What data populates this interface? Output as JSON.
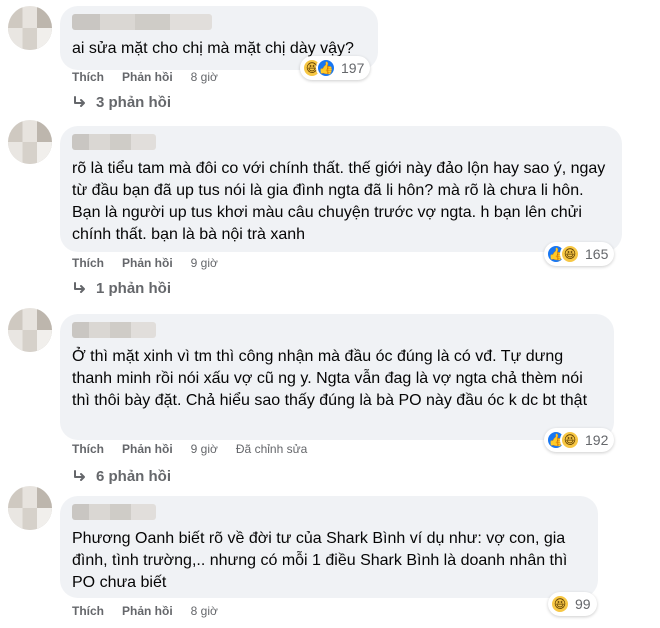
{
  "comments": [
    {
      "text": "ai sửa mặt cho chị mà mặt chị dày vậy?",
      "reaction_count": "197",
      "like_label": "Thích",
      "reply_label": "Phản hồi",
      "time": "8 giờ",
      "replies_label": "3 phản hồi"
    },
    {
      "text": "rõ là tiểu tam mà đôi co với chính thất. thế giới này đảo lộn hay sao ý, ngay từ đầu bạn đã up tus nói là gia đình ngta đã li hôn? mà rõ là chưa li hôn. Bạn là người up tus khơi màu câu chuyện trước vợ ngta. h bạn lên chửi chính thất. bạn là bà nội trà xanh",
      "reaction_count": "165",
      "like_label": "Thích",
      "reply_label": "Phản hồi",
      "time": "9 giờ",
      "replies_label": "1 phản hồi"
    },
    {
      "text": "Ở thì mặt xinh vì tm thì công nhận mà đầu óc đúng là có vđ. Tự dưng thanh minh rồi nói xấu vợ cũ ng y. Ngta vẫn đag là vợ ngta chả thèm nói thì thôi bày đặt. Chả hiểu sao thấy đúng là bà PO này đầu óc k dc bt thật",
      "reaction_count": "192",
      "like_label": "Thích",
      "reply_label": "Phản hồi",
      "time": "9 giờ",
      "edited": "Đã chỉnh sửa",
      "replies_label": "6 phản hồi"
    },
    {
      "text": "Phương Oanh biết rõ về đời tư của Shark Bình ví dụ như: vợ con, gia đình, tình trường,.. nhưng có mỗi 1 điều Shark Bình là doanh nhân thì PO chưa biết",
      "reaction_count": "99",
      "like_label": "Thích",
      "reply_label": "Phản hồi",
      "time": "8 giờ"
    }
  ],
  "icons": {
    "like": "like-icon",
    "haha": "haha-icon",
    "reply_arrow": "reply-arrow-icon"
  },
  "colors": {
    "bubble": "#f0f2f5",
    "like_blue": "#1877f2",
    "haha_yellow": "#f7c744",
    "secondary_text": "#65676b"
  }
}
